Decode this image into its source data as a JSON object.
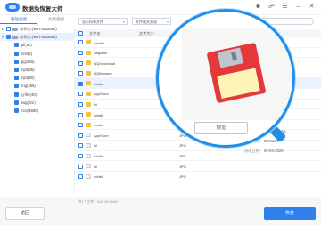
{
  "app": {
    "title": "数据兔恢复大师"
  },
  "left_tabs": [
    "路径视图",
    "文件视图"
  ],
  "tree": {
    "roots": [
      "软件(D:)WTFS(20685)",
      "软件(D:)WTFS(20685)"
    ],
    "folders": [
      "jpf(1G)",
      "html(3)",
      "jpg(456)",
      "mp3(45)",
      "mp4(90)",
      "png(456)",
      "rg-file(40)",
      "swg(2Gi)",
      "mov(4680)"
    ]
  },
  "filters": {
    "file_filter": "显示所有文件",
    "format_filter": "文件格式筛选"
  },
  "list": {
    "headers": [
      "文件名",
      "文件大小"
    ],
    "rows": [
      {
        "name": "wecfiot",
        "type": ""
      },
      {
        "name": "wegame",
        "type": ""
      },
      {
        "name": "QQDownload",
        "type": ""
      },
      {
        "name": "QQBrowser",
        "type": ""
      },
      {
        "name": "music",
        "type": ""
      },
      {
        "name": "AppStore",
        "type": ""
      },
      {
        "name": "lol",
        "type": ""
      },
      {
        "name": "ucfalk",
        "type": ""
      },
      {
        "name": "music",
        "type": ""
      },
      {
        "name": "AppStore",
        "type": "JPG"
      },
      {
        "name": "lol",
        "type": "JPG"
      },
      {
        "name": "ucfalk",
        "type": "JPG"
      },
      {
        "name": "lol",
        "type": "JPG"
      },
      {
        "name": "ucfalk",
        "type": "JPG"
      }
    ]
  },
  "details": {
    "path_label": "文件路径：",
    "path_value": "D:/music",
    "date_label": "修改日期：",
    "date_value": "02-04-2020",
    "name_value": "music"
  },
  "lens": {
    "preview_label": "预览"
  },
  "footer": {
    "count_text": "共1个文件，6(6)·45.94Mb",
    "back_label": "返回",
    "recover_label": "恢复"
  },
  "colors": {
    "accent": "#2f80ed",
    "lens_ring": "#1f8fe8"
  }
}
